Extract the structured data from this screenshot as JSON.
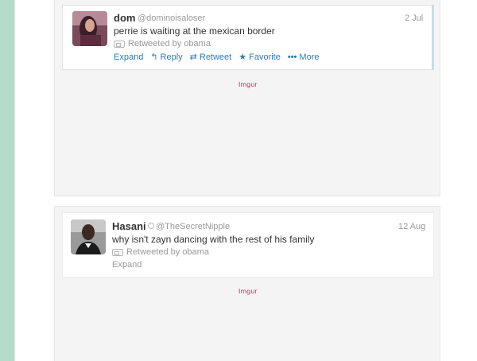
{
  "posts": [
    {
      "tweet": {
        "name": "dom",
        "handle": "@dominoisaloser",
        "date": "2 Jul",
        "text": "perrie is waiting at the mexican border",
        "retweeted_by": "Retweeted by obama",
        "actions": {
          "expand": "Expand",
          "reply": "Reply",
          "retweet": "Retweet",
          "favorite": "Favorite",
          "more": "More"
        }
      },
      "caption": "Imgur"
    },
    {
      "tweet": {
        "name": "Hasani",
        "handle": "@TheSecretNipple",
        "date": "12 Aug",
        "text": "why isn't zayn dancing with the rest of his family",
        "retweeted_by": "Retweeted by obama",
        "expand": "Expand"
      },
      "caption": "Imgur"
    }
  ],
  "colors": {
    "link": "#2b7bb9",
    "muted": "#999999",
    "caption": "#d7263d",
    "left_strip": "#b5dcc8"
  },
  "icons": {
    "reply": "reply-arrow-icon",
    "retweet": "retweet-icon",
    "favorite": "star-icon",
    "more": "ellipsis-icon",
    "retweeted": "retweet-badge-icon"
  }
}
